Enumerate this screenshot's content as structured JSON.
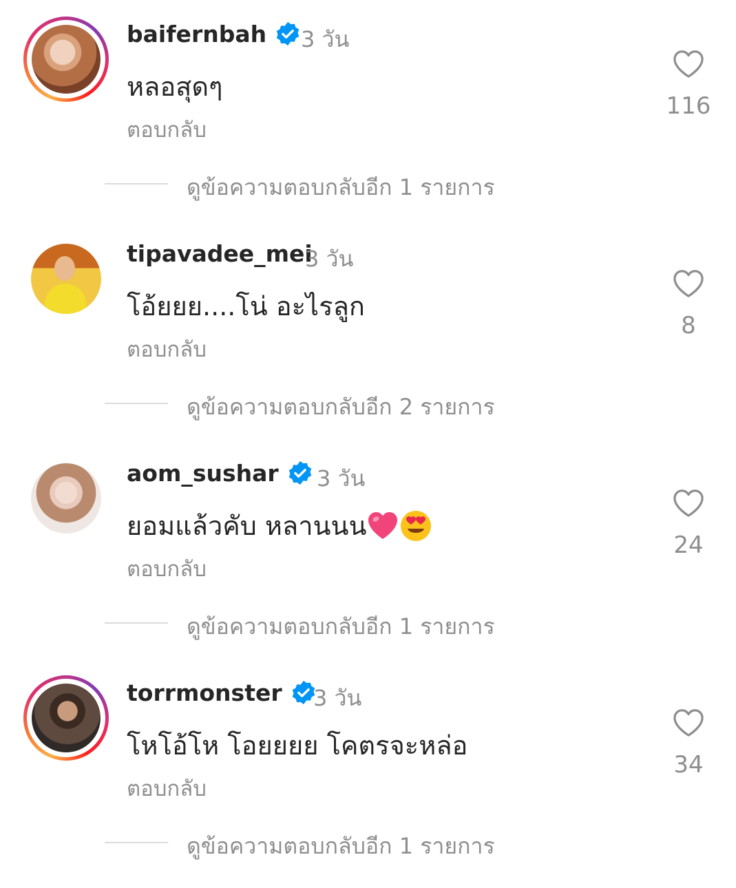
{
  "comments": [
    {
      "username": "baifernbah",
      "verified": true,
      "time": "3 วัน",
      "text": "หลอสุดๆ",
      "reply": "ตอบกลับ",
      "likes": "116",
      "view_replies": "ดูข้อความตอบกลับอีก 1 รายการ"
    },
    {
      "username": "tipavadee_mei",
      "verified": false,
      "time": "3 วัน",
      "text": "โอ้ยยย....โน่ อะไรลูก",
      "reply": "ตอบกลับ",
      "likes": "8",
      "view_replies": "ดูข้อความตอบกลับอีก 2 รายการ"
    },
    {
      "username": "aom_sushar",
      "verified": true,
      "time": "3 วัน",
      "text": "ยอมแล้วคับ หลานนน",
      "text_emojis": [
        "pink-heart-emoji",
        "heart-eyes-emoji"
      ],
      "reply": "ตอบกลับ",
      "likes": "24",
      "view_replies": "ดูข้อความตอบกลับอีก 1 รายการ"
    },
    {
      "username": "torrmonster",
      "verified": true,
      "time": "3 วัน",
      "text": "โหโอ้โห โอยยยย โคตรจะหล่อ",
      "reply": "ตอบกลับ",
      "likes": "34",
      "view_replies": "ดูข้อความตอบกลับอีก 1 รายการ"
    }
  ],
  "colors": {
    "verified_blue": "#0095f6",
    "muted_text": "#8e8e8e",
    "primary_text": "#262626"
  }
}
